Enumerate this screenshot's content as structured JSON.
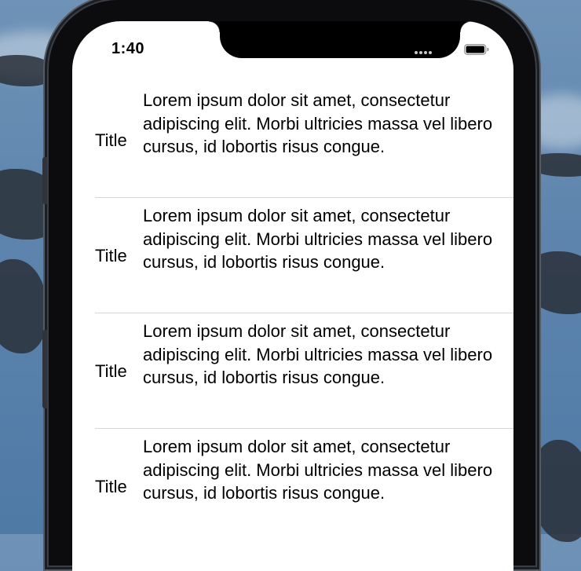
{
  "status_bar": {
    "time": "1:40",
    "icons": [
      "cellular-signal-icon",
      "wifi-icon",
      "battery-icon"
    ]
  },
  "list": {
    "rows": [
      {
        "title": "Title",
        "body": "Lorem ipsum dolor sit amet, consectetur adipiscing elit. Morbi ultricies massa vel libero cursus, id lobortis risus congue."
      },
      {
        "title": "Title",
        "body": "Lorem ipsum dolor sit amet, consectetur adipiscing elit. Morbi ultricies massa vel libero cursus, id lobortis risus congue."
      },
      {
        "title": "Title",
        "body": "Lorem ipsum dolor sit amet, consectetur adipiscing elit. Morbi ultricies massa vel libero cursus, id lobortis risus congue."
      },
      {
        "title": "Title",
        "body": "Lorem ipsum dolor sit amet, consectetur adipiscing elit. Morbi ultricies massa vel libero cursus, id lobortis risus congue."
      }
    ]
  },
  "colors": {
    "screen_background": "#ffffff",
    "text": "#000000",
    "separator": "#d6d6d8",
    "device_frame": "#0c0c0e",
    "wallpaper": "#5d84ad"
  }
}
